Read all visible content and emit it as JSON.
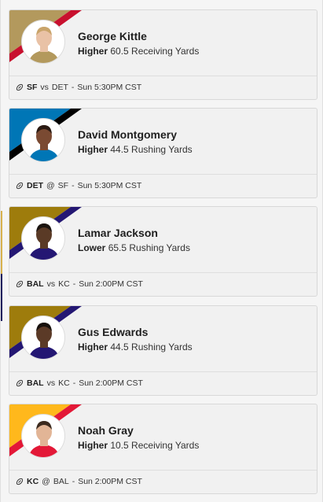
{
  "cards": [
    {
      "player": "George Kittle",
      "direction": "Higher",
      "stat": "60.5 Receiving Yards",
      "team": "SF",
      "connector": "vs",
      "opponent": "DET",
      "time": "Sun 5:30PM CST",
      "colors": {
        "primary": "#b3995d",
        "secondary": "#aa0000",
        "stripe": "#c8102e"
      },
      "avatar": {
        "skin": "#e9c2a6",
        "hair": "#c9a46a",
        "jersey": "#b3995d"
      }
    },
    {
      "player": "David Montgomery",
      "direction": "Higher",
      "stat": "44.5 Rushing Yards",
      "team": "DET",
      "connector": "@",
      "opponent": "SF",
      "time": "Sun 5:30PM CST",
      "colors": {
        "primary": "#0076b6",
        "secondary": "#111111",
        "stripe": "#000000"
      },
      "avatar": {
        "skin": "#7a4a32",
        "hair": "#2a1a12",
        "jersey": "#0076b6"
      }
    },
    {
      "player": "Lamar Jackson",
      "direction": "Lower",
      "stat": "65.5 Rushing Yards",
      "team": "BAL",
      "connector": "vs",
      "opponent": "KC",
      "time": "Sun 2:00PM CST",
      "colors": {
        "primary": "#9e7c0c",
        "secondary": "#241773",
        "stripe": "#241773"
      },
      "avatar": {
        "skin": "#5a3a26",
        "hair": "#1b1410",
        "jersey": "#241773"
      }
    },
    {
      "player": "Gus Edwards",
      "direction": "Higher",
      "stat": "44.5 Rushing Yards",
      "team": "BAL",
      "connector": "vs",
      "opponent": "KC",
      "time": "Sun 2:00PM CST",
      "colors": {
        "primary": "#9e7c0c",
        "secondary": "#241773",
        "stripe": "#241773"
      },
      "avatar": {
        "skin": "#5b3a27",
        "hair": "#17110d",
        "jersey": "#241773"
      }
    },
    {
      "player": "Noah Gray",
      "direction": "Higher",
      "stat": "10.5 Receiving Yards",
      "team": "KC",
      "connector": "@",
      "opponent": "BAL",
      "time": "Sun 2:00PM CST",
      "colors": {
        "primary": "#ffb81c",
        "secondary": "#e31837",
        "stripe": "#e31837"
      },
      "avatar": {
        "skin": "#e2b596",
        "hair": "#3b2a1e",
        "jersey": "#e31837"
      }
    }
  ]
}
